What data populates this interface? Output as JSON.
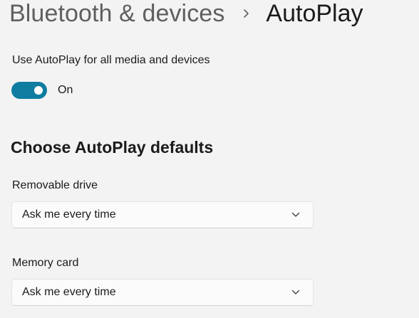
{
  "header": {
    "parent": "Bluetooth & devices",
    "current": "AutoPlay",
    "separator_icon": "chevron-right-icon"
  },
  "autoplay_toggle": {
    "label": "Use AutoPlay for all media and devices",
    "state_text": "On",
    "on": true,
    "accent_color": "#0f7da0"
  },
  "defaults": {
    "title": "Choose AutoPlay defaults",
    "removable_drive": {
      "label": "Removable drive",
      "value": "Ask me every time",
      "icon": "chevron-down-icon"
    },
    "memory_card": {
      "label": "Memory card",
      "value": "Ask me every time",
      "icon": "chevron-down-icon"
    }
  }
}
